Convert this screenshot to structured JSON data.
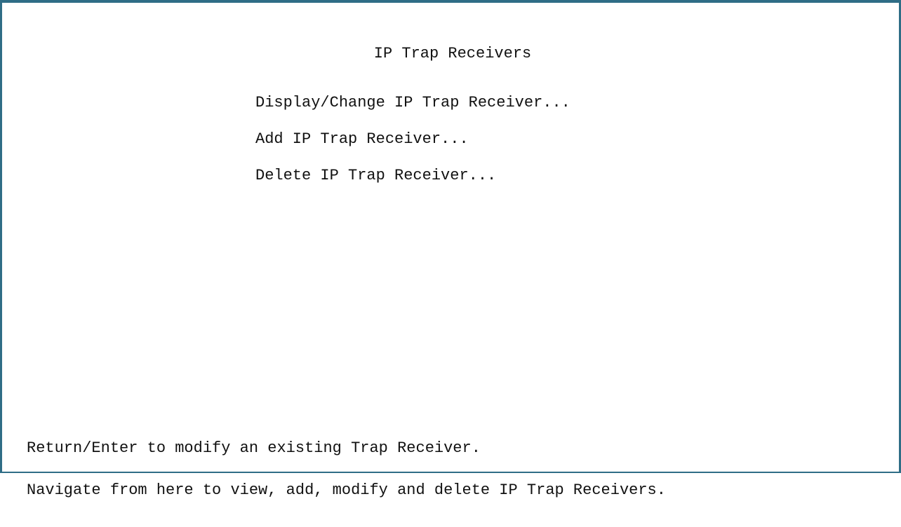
{
  "screen": {
    "title": "IP Trap Receivers"
  },
  "menu": {
    "items": [
      {
        "label": "Display/Change IP Trap Receiver..."
      },
      {
        "label": "Add IP Trap Receiver..."
      },
      {
        "label": "Delete IP Trap Receiver..."
      }
    ]
  },
  "help": {
    "line1": "Return/Enter to modify an existing Trap Receiver.",
    "line2": "Navigate from here to view, add, modify and delete IP Trap Receivers."
  },
  "colors": {
    "frame_border": "#2f6d86",
    "background": "#ffffff",
    "text": "#111111"
  }
}
